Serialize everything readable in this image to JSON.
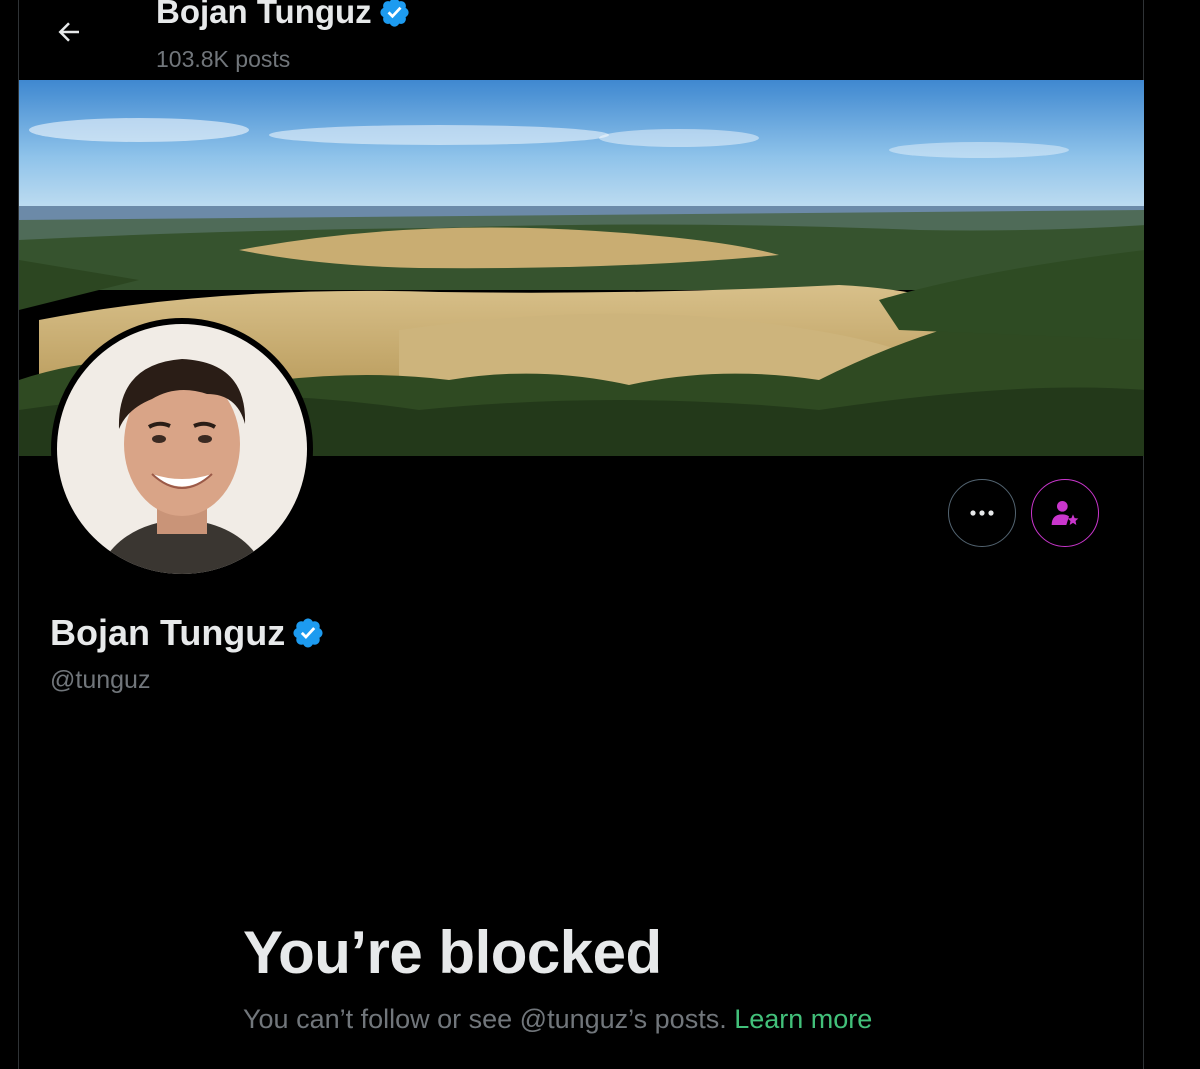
{
  "header": {
    "name": "Bojan Tunguz",
    "posts": "103.8K posts"
  },
  "profile": {
    "name": "Bojan Tunguz",
    "handle": "@tunguz",
    "verified": true
  },
  "blocked": {
    "title": "You’re blocked",
    "message": "You can’t follow or see @tunguz’s posts.",
    "link": "Learn more"
  },
  "colors": {
    "background": "#000000",
    "verified": "#1d9bf0",
    "subscribe_accent": "#c936cc",
    "link": "#42c07a",
    "secondary_text": "#71767b"
  },
  "icons": {
    "back": "arrow-left-icon",
    "more": "more-dots-icon",
    "subscribe": "person-star-icon",
    "verified": "verified-badge-icon"
  }
}
